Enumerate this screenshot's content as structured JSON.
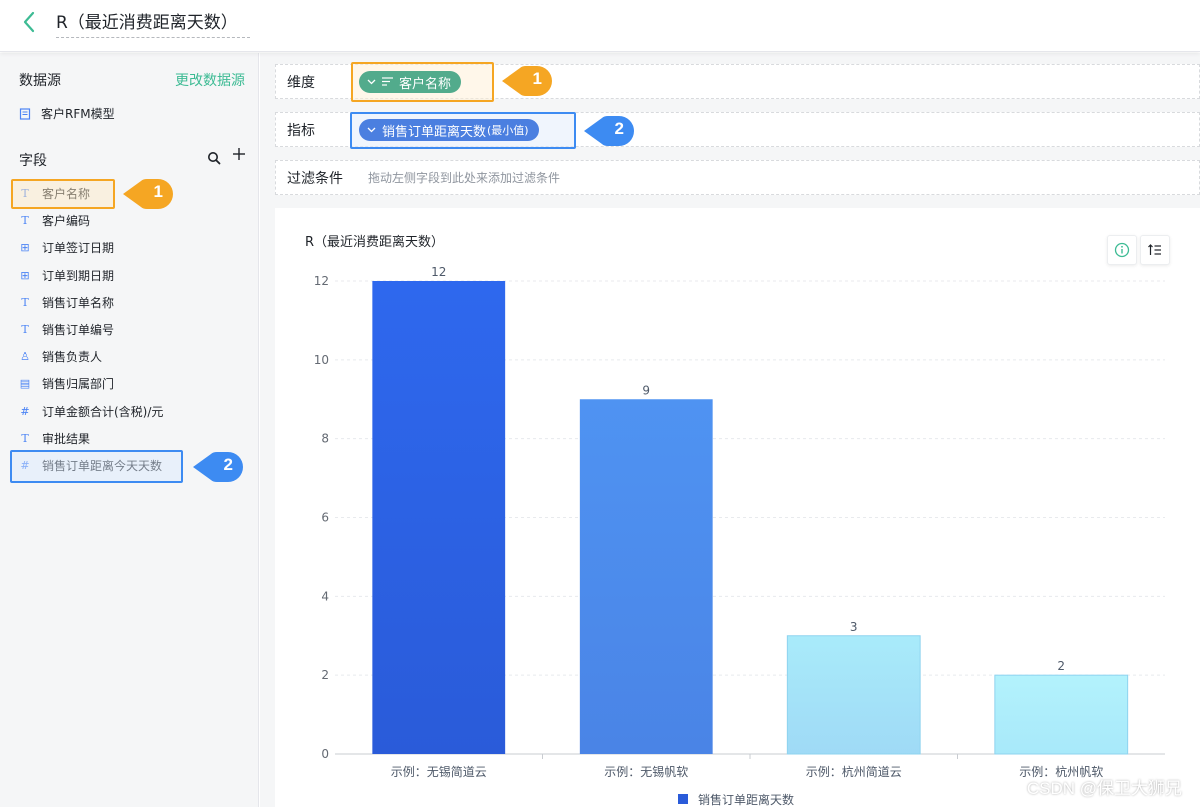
{
  "header": {
    "title": "R（最近消费距离天数）"
  },
  "sidebar": {
    "datasource_label": "数据源",
    "change_datasource": "更改数据源",
    "datasource_name": "客户RFM模型",
    "fields_label": "字段",
    "fields": [
      {
        "label": "客户名称",
        "icon": "text-type-icon",
        "glyph": "T"
      },
      {
        "label": "客户编码",
        "icon": "text-type-icon",
        "glyph": "T"
      },
      {
        "label": "订单签订日期",
        "icon": "date-type-icon",
        "glyph": "⊞"
      },
      {
        "label": "订单到期日期",
        "icon": "date-type-icon",
        "glyph": "⊞"
      },
      {
        "label": "销售订单名称",
        "icon": "text-type-icon",
        "glyph": "T"
      },
      {
        "label": "销售订单编号",
        "icon": "text-type-icon",
        "glyph": "T"
      },
      {
        "label": "销售负责人",
        "icon": "person-type-icon",
        "glyph": "♙"
      },
      {
        "label": "销售归属部门",
        "icon": "department-type-icon",
        "glyph": "▤"
      },
      {
        "label": "订单金额合计(含税)/元",
        "icon": "number-type-icon",
        "glyph": "#"
      },
      {
        "label": "审批结果",
        "icon": "text-type-icon",
        "glyph": "T"
      },
      {
        "label": "销售订单距离今天天数",
        "icon": "number-type-icon",
        "glyph": "#"
      }
    ]
  },
  "config": {
    "dimension_label": "维度",
    "dimension_pill": "客户名称",
    "metric_label": "指标",
    "metric_pill": "销售订单距离天数",
    "metric_agg": "(最小值)",
    "filter_label": "过滤条件",
    "filter_hint": "拖动左侧字段到此处来添加过滤条件"
  },
  "annotations": {
    "badge_1": "1",
    "badge_2": "2"
  },
  "colors": {
    "accent_green": "#3dbb94",
    "highlight_orange": "#f5a623",
    "highlight_blue": "#3d8bf2"
  },
  "watermark": "CSDN @保卫大狮兄",
  "chart_data": {
    "type": "bar",
    "title": "R（最近消费距离天数）",
    "categories": [
      "示例：无锡简道云",
      "示例：无锡帆软",
      "示例：杭州简道云",
      "示例：杭州帆软"
    ],
    "series": [
      {
        "name": "销售订单距离天数",
        "values": [
          12,
          9,
          3,
          2
        ]
      }
    ],
    "data_labels": [
      "12",
      "9",
      "3",
      "2"
    ],
    "ylim": [
      0,
      12
    ],
    "yticks": [
      0,
      2,
      4,
      6,
      8,
      10,
      12
    ],
    "grid": true,
    "legend": "bottom-center"
  }
}
